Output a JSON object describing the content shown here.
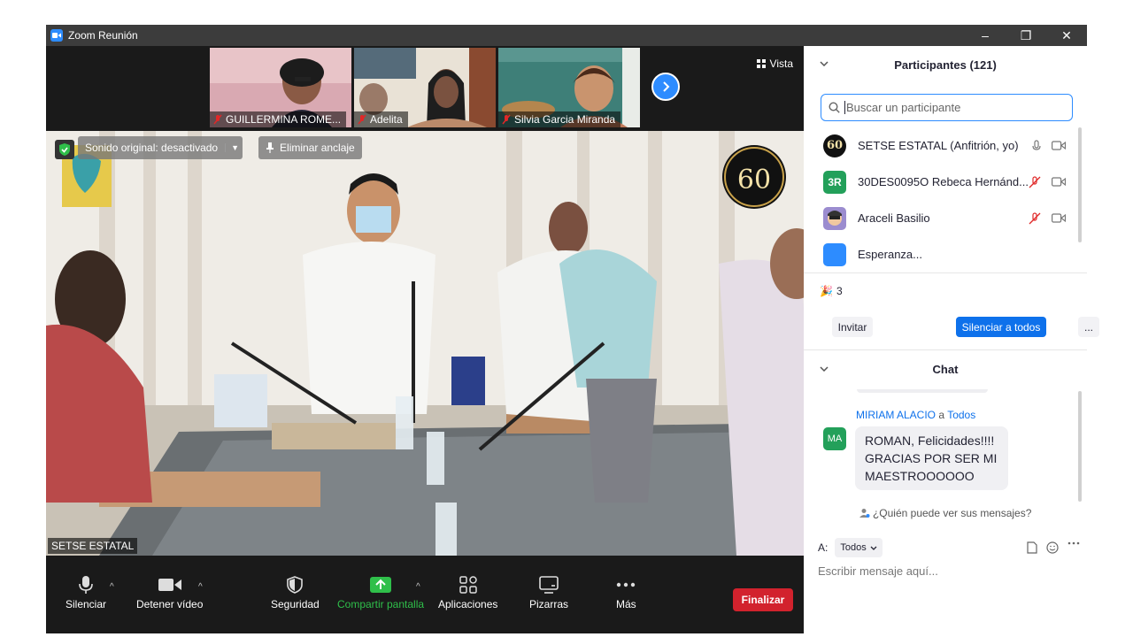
{
  "window": {
    "title": "Zoom Reunión",
    "controls": [
      "–",
      "❐",
      "✕"
    ]
  },
  "thumbnails": [
    {
      "name": "GUILLERMINA ROME...",
      "muted": true
    },
    {
      "name": "Adelita",
      "muted": true
    },
    {
      "name": "Silvia Garcia Miranda",
      "muted": true
    }
  ],
  "view_button": "Vista",
  "main_video": {
    "speaker": "SETSE ESTATAL",
    "original_sound": "Sonido original: desactivado",
    "unpin": "Eliminar anclaje",
    "badge_text": "60"
  },
  "toolbar": {
    "mute": "Silenciar",
    "stop_video": "Detener vídeo",
    "security": "Seguridad",
    "share_screen": "Compartir pantalla",
    "apps": "Aplicaciones",
    "whiteboards": "Pizarras",
    "more": "Más",
    "end": "Finalizar"
  },
  "participants": {
    "header": "Participantes (121)",
    "search_placeholder": "Buscar un participante",
    "list": [
      {
        "name": "SETSE ESTATAL (Anfitrión, yo)",
        "avatar_text": "60",
        "avatar_color": "#111111"
      },
      {
        "name": "30DES0095O  Rebeca Hernánd...",
        "avatar_text": "3R",
        "avatar_color": "#23a05a"
      },
      {
        "name": "Araceli Basilio",
        "avatar_text": "",
        "avatar_color": "#9b8ccf"
      },
      {
        "name": "Esperanza...",
        "avatar_text": "",
        "avatar_color": "#2d8cff"
      }
    ],
    "reaction_count": "3",
    "invite": "Invitar",
    "mute_all": "Silenciar a todos",
    "more": "..."
  },
  "chat": {
    "header": "Chat",
    "sender": "MIRIAM ALACIO",
    "to_word": "a",
    "recipient": "Todos",
    "avatar": "MA",
    "message": "ROMAN, Felicidades!!!! GRACIAS POR SER MI MAESTROOOOOO",
    "who_sees": "¿Quién puede ver sus mensajes?",
    "to_label": "A:",
    "to_value": "Todos",
    "input_placeholder": "Escribir mensaje aquí..."
  },
  "colors": {
    "accent": "#2d8cff",
    "end": "#d2222d",
    "share": "#2fbf4a"
  }
}
